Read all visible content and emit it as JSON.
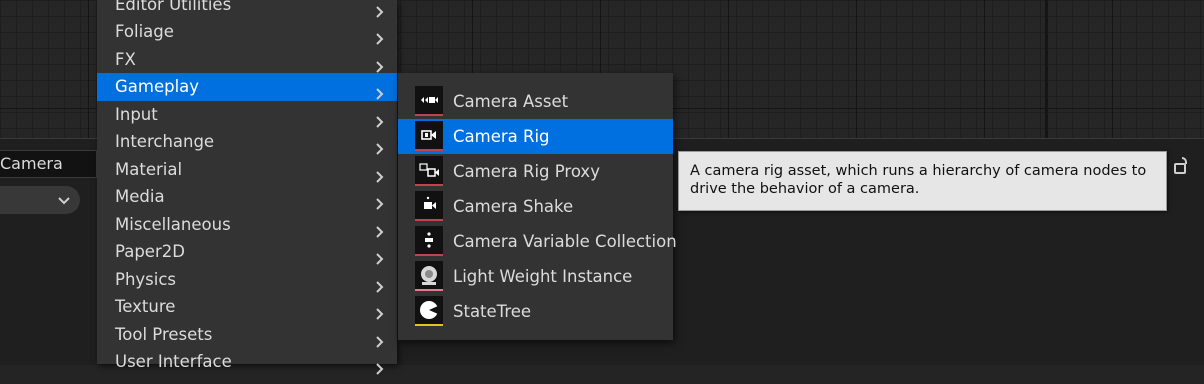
{
  "name_field": {
    "value": "Camera"
  },
  "menu": {
    "items": [
      {
        "label": "Editor Utilities",
        "has_submenu": true,
        "active": false
      },
      {
        "label": "Foliage",
        "has_submenu": true,
        "active": false
      },
      {
        "label": "FX",
        "has_submenu": true,
        "active": false
      },
      {
        "label": "Gameplay",
        "has_submenu": true,
        "active": true
      },
      {
        "label": "Input",
        "has_submenu": true,
        "active": false
      },
      {
        "label": "Interchange",
        "has_submenu": true,
        "active": false
      },
      {
        "label": "Material",
        "has_submenu": true,
        "active": false
      },
      {
        "label": "Media",
        "has_submenu": true,
        "active": false
      },
      {
        "label": "Miscellaneous",
        "has_submenu": true,
        "active": false
      },
      {
        "label": "Paper2D",
        "has_submenu": true,
        "active": false
      },
      {
        "label": "Physics",
        "has_submenu": true,
        "active": false
      },
      {
        "label": "Texture",
        "has_submenu": true,
        "active": false
      },
      {
        "label": "Tool Presets",
        "has_submenu": true,
        "active": false
      },
      {
        "label": "User Interface",
        "has_submenu": true,
        "active": false
      }
    ]
  },
  "submenu": {
    "items": [
      {
        "label": "Camera Asset",
        "icon": "camera-asset-icon",
        "accent": "#c2434f",
        "active": false
      },
      {
        "label": "Camera Rig",
        "icon": "camera-rig-icon",
        "accent": "#c2434f",
        "active": true
      },
      {
        "label": "Camera Rig Proxy",
        "icon": "camera-rig-proxy-icon",
        "accent": "#c2434f",
        "active": false
      },
      {
        "label": "Camera Shake",
        "icon": "camera-shake-icon",
        "accent": "#c2434f",
        "active": false
      },
      {
        "label": "Camera Variable Collection",
        "icon": "camera-variable-collection-icon",
        "accent": "#c2434f",
        "active": false
      },
      {
        "label": "Light Weight Instance",
        "icon": "light-weight-instance-icon",
        "accent": "#e27a93",
        "active": false
      },
      {
        "label": "StateTree",
        "icon": "statetree-icon",
        "accent": "#e8c020",
        "active": false
      }
    ]
  },
  "tooltip": {
    "text": "A camera rig asset, which runs a hierarchy of camera nodes to drive the behavior of a camera."
  },
  "colors": {
    "accent": "#0070e0",
    "menu_bg": "#333333",
    "tooltip_bg": "#e6e6e6"
  }
}
